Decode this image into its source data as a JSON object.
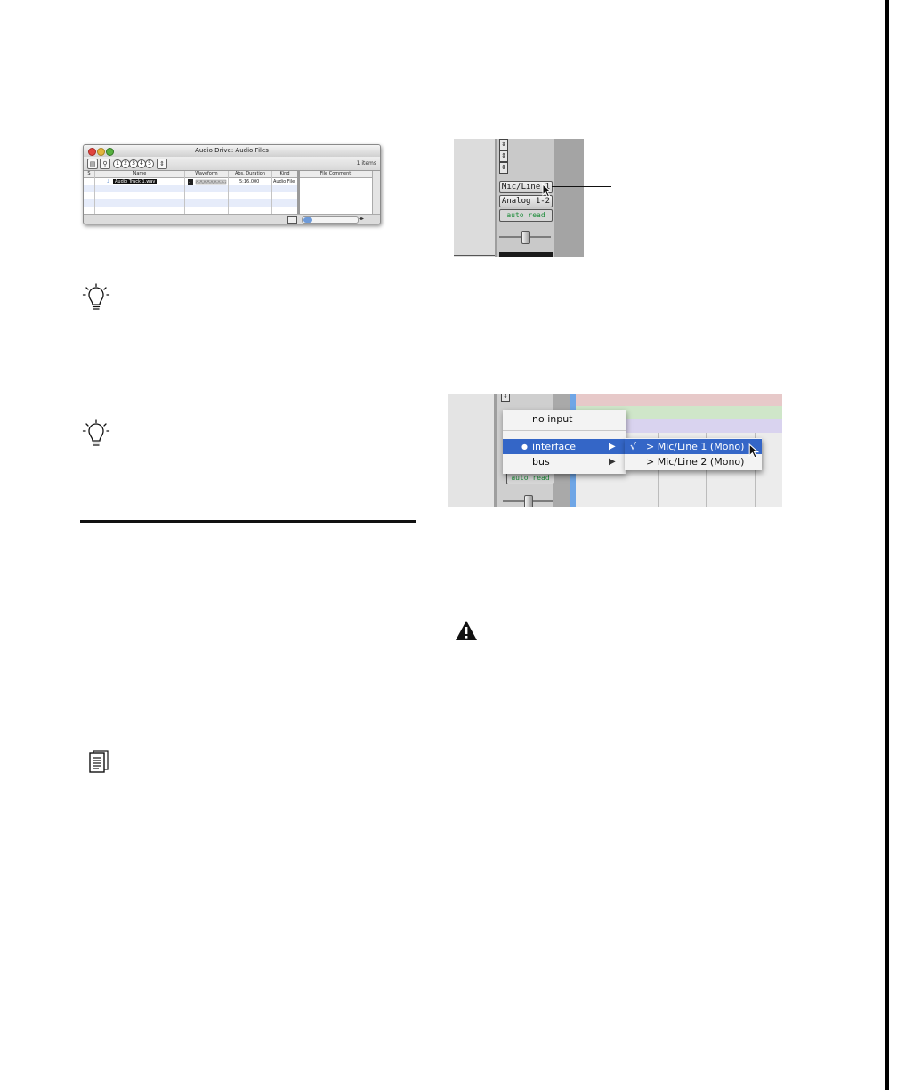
{
  "finder_window": {
    "title": "Audio Drive: Audio Files",
    "item_count": "1 items",
    "view_buttons": [
      "1",
      "2",
      "3",
      "4",
      "5"
    ],
    "columns": [
      "S",
      "Name",
      "Waveform",
      "Abs. Duration",
      "Kind",
      "File Comment"
    ],
    "row": {
      "name": "Audio Track 1.wav",
      "duration": "5:16.000",
      "kind": "Audio File"
    },
    "colors": {
      "close": "#e0443e",
      "minimize": "#e2b53d",
      "zoom": "#57b13f",
      "stripe": "#e6ecfa"
    }
  },
  "mixer_input": {
    "input_button": "Mic/Line 1",
    "output_button": "Analog 1-2",
    "automation_button": "auto read",
    "automation_color": "#1e8c3a"
  },
  "input_menu": {
    "automation_button": "auto read",
    "items": [
      "no input",
      "interface",
      "bus"
    ],
    "selected": "interface",
    "submenu": [
      {
        "label": "> Mic/Line 1 (Mono)",
        "checked": "√"
      },
      {
        "label": "> Mic/Line 2 (Mono)",
        "checked": ""
      }
    ],
    "highlight_color": "#3466c7",
    "track_colors": [
      "#e7c9c9",
      "#cfe6c9",
      "#d9d3ef"
    ]
  },
  "icons": [
    "tip-icon",
    "tip-icon",
    "warning-icon",
    "note-icon"
  ]
}
